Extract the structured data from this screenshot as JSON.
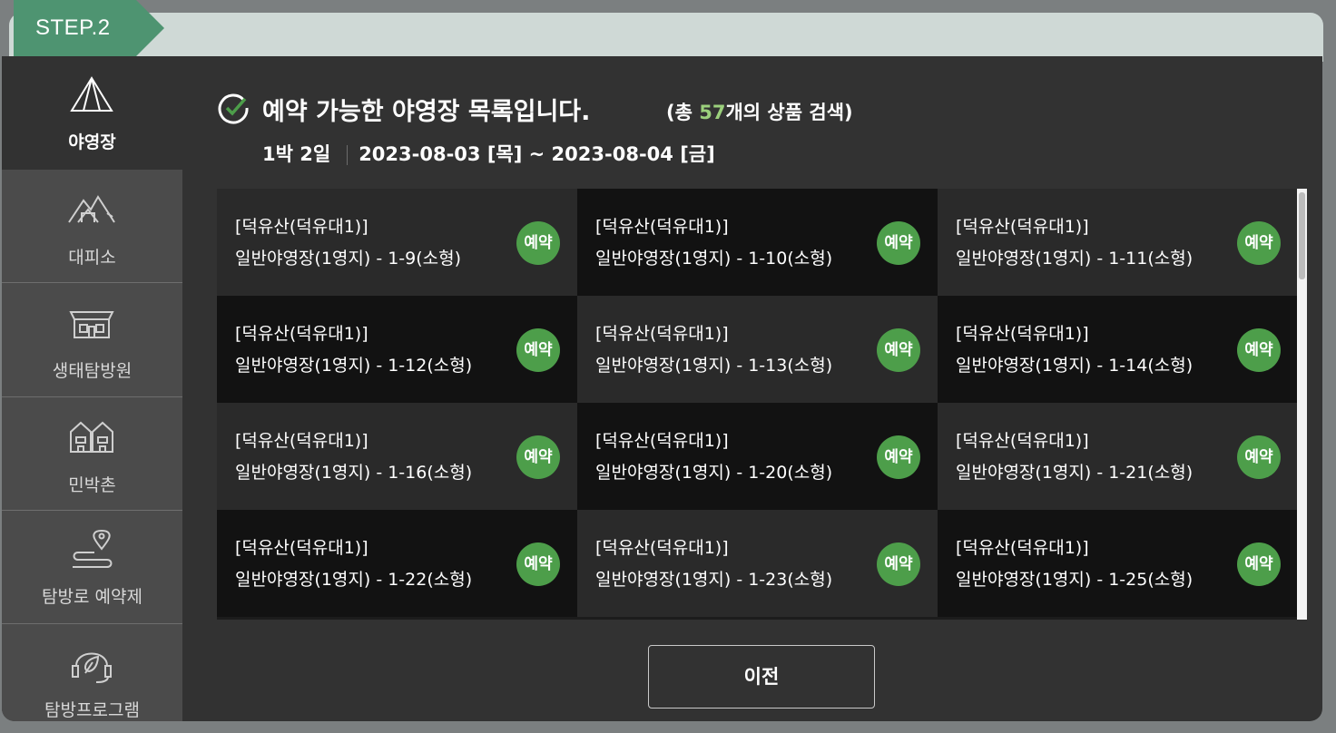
{
  "step_label": "STEP.2",
  "sidebar": {
    "items": [
      {
        "label": "야영장",
        "icon": "tent-icon",
        "active": true
      },
      {
        "label": "대피소",
        "icon": "mountain-shelter-icon",
        "active": false
      },
      {
        "label": "생태탐방원",
        "icon": "building-icon",
        "active": false
      },
      {
        "label": "민박촌",
        "icon": "houses-icon",
        "active": false
      },
      {
        "label": "탐방로 예약제",
        "icon": "trail-pin-icon",
        "active": false
      },
      {
        "label": "탐방프로그램",
        "icon": "headset-leaf-icon",
        "active": false
      }
    ]
  },
  "header": {
    "title": "예약 가능한 야영장 목록입니다.",
    "count_prefix": "(총 ",
    "count_value": "57",
    "count_suffix": "개의 상품 검색)"
  },
  "dates": {
    "nights": "1박 2일",
    "range": "2023-08-03 [목] ~ 2023-08-04 [금]"
  },
  "colors": {
    "accent_green": "#4d9e4a",
    "count_green": "#9bd07c",
    "step_green": "#4e9471"
  },
  "reserve_label": "예약",
  "items": [
    {
      "place": "[덕유산(덕유대1)]",
      "site": "일반야영장(1영지) - 1-9(소형)"
    },
    {
      "place": "[덕유산(덕유대1)]",
      "site": "일반야영장(1영지) - 1-10(소형)"
    },
    {
      "place": "[덕유산(덕유대1)]",
      "site": "일반야영장(1영지) - 1-11(소형)"
    },
    {
      "place": "[덕유산(덕유대1)]",
      "site": "일반야영장(1영지) - 1-12(소형)"
    },
    {
      "place": "[덕유산(덕유대1)]",
      "site": "일반야영장(1영지) - 1-13(소형)"
    },
    {
      "place": "[덕유산(덕유대1)]",
      "site": "일반야영장(1영지) - 1-14(소형)"
    },
    {
      "place": "[덕유산(덕유대1)]",
      "site": "일반야영장(1영지) - 1-16(소형)"
    },
    {
      "place": "[덕유산(덕유대1)]",
      "site": "일반야영장(1영지) - 1-20(소형)"
    },
    {
      "place": "[덕유산(덕유대1)]",
      "site": "일반야영장(1영지) - 1-21(소형)"
    },
    {
      "place": "[덕유산(덕유대1)]",
      "site": "일반야영장(1영지) - 1-22(소형)"
    },
    {
      "place": "[덕유산(덕유대1)]",
      "site": "일반야영장(1영지) - 1-23(소형)"
    },
    {
      "place": "[덕유산(덕유대1)]",
      "site": "일반야영장(1영지) - 1-25(소형)"
    }
  ],
  "back_button": "이전"
}
